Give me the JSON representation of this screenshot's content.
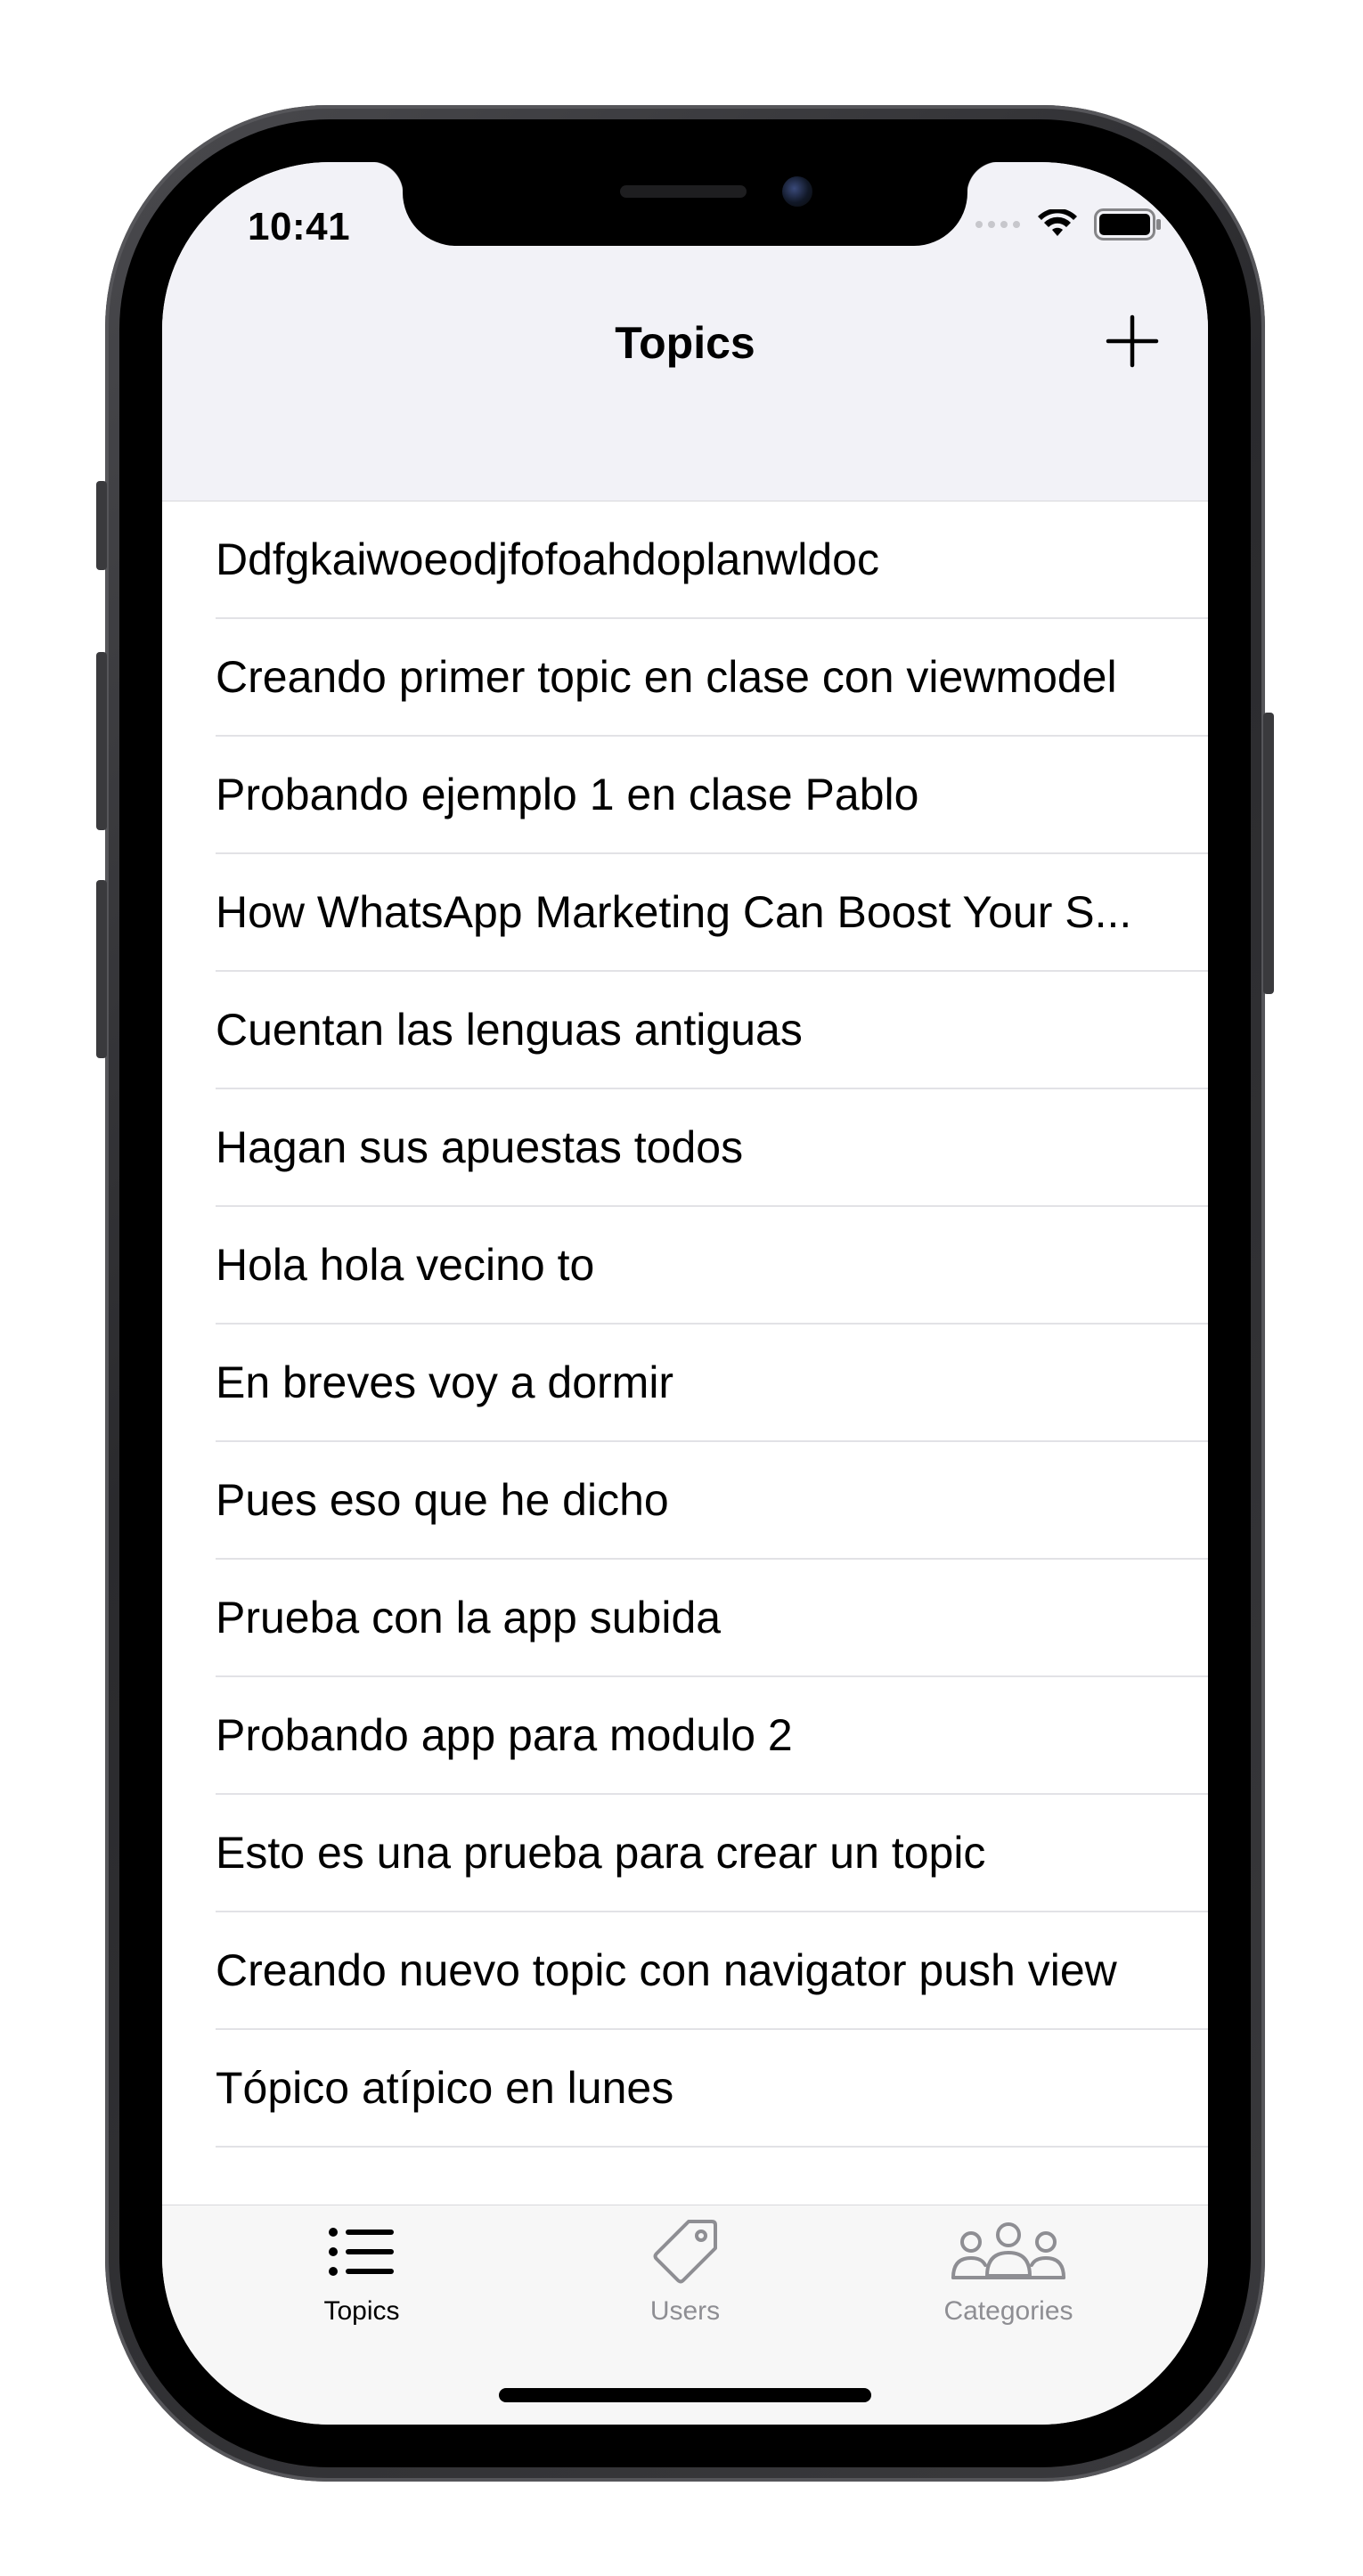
{
  "status_bar": {
    "time": "10:41"
  },
  "nav": {
    "title": "Topics",
    "add_icon": "plus-icon"
  },
  "topics": [
    "Ddfgkaiwoeodjfofoahdoplanwldoc",
    "Creando primer topic en clase con viewmodel",
    "Probando ejemplo 1 en clase Pablo",
    "How WhatsApp Marketing Can Boost Your S...",
    "Cuentan las lenguas antiguas",
    "Hagan sus apuestas todos",
    "Hola hola vecino to",
    "En breves voy a dormir",
    "Pues eso que he dicho",
    "Prueba con la app subida",
    "Probando app para modulo 2",
    "Esto es una prueba para crear un topic",
    "Creando nuevo topic con navigator push view",
    "Tópico atípico en lunes",
    ""
  ],
  "tabbar": {
    "items": [
      {
        "label": "Topics",
        "icon": "list-icon",
        "active": true
      },
      {
        "label": "Users",
        "icon": "tag-icon",
        "active": false
      },
      {
        "label": "Categories",
        "icon": "group-icon",
        "active": false
      }
    ]
  },
  "colors": {
    "nav_background": "#f2f2f7",
    "tab_active": "#000000",
    "tab_inactive": "#8e8e93",
    "separator": "#e2e2e6"
  }
}
